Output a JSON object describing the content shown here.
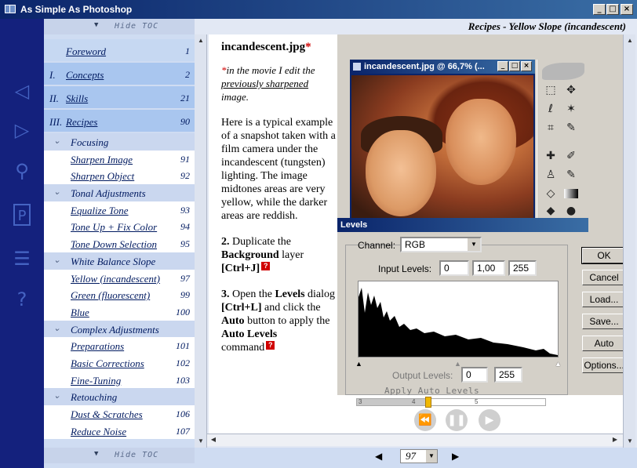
{
  "window": {
    "title": "As Simple As Photoshop"
  },
  "toc": {
    "hide_label": "Hide TOC",
    "items": [
      {
        "type": "chapter",
        "roman": "",
        "label": "Foreword",
        "page": "1"
      },
      {
        "type": "chapter",
        "roman": "I.",
        "label": "Concepts",
        "page": "2"
      },
      {
        "type": "chapter",
        "roman": "II.",
        "label": "Skills",
        "page": "21"
      },
      {
        "type": "chapter",
        "roman": "III.",
        "label": "Recipes",
        "page": "90"
      },
      {
        "type": "section",
        "label": "Focusing"
      },
      {
        "type": "leaf",
        "label": "Sharpen Image",
        "page": "91"
      },
      {
        "type": "leaf",
        "label": "Sharpen Object",
        "page": "92"
      },
      {
        "type": "section",
        "label": "Tonal Adjustments"
      },
      {
        "type": "leaf",
        "label": "Equalize Tone",
        "page": "93"
      },
      {
        "type": "leaf",
        "label": "Tone Up + Fix Color",
        "page": "94"
      },
      {
        "type": "leaf",
        "label": "Tone Down Selection",
        "page": "95"
      },
      {
        "type": "section",
        "label": "White Balance Slope"
      },
      {
        "type": "leaf",
        "label": "Yellow (incandescent)",
        "page": "97"
      },
      {
        "type": "leaf",
        "label": "Green (fluorescent)",
        "page": "99"
      },
      {
        "type": "leaf",
        "label": "Blue",
        "page": "100"
      },
      {
        "type": "section",
        "label": "Complex Adjustments"
      },
      {
        "type": "leaf",
        "label": "Preparations",
        "page": "101"
      },
      {
        "type": "leaf",
        "label": "Basic Corrections",
        "page": "102"
      },
      {
        "type": "leaf",
        "label": "Fine-Tuning",
        "page": "103"
      },
      {
        "type": "section",
        "label": "Retouching"
      },
      {
        "type": "leaf",
        "label": "Dust & Scratches",
        "page": "106"
      },
      {
        "type": "leaf",
        "label": "Reduce Noise",
        "page": "107"
      }
    ]
  },
  "content": {
    "title": "Recipes - Yellow Slope (incandescent)",
    "filename": "incandescent.jpg",
    "note_before": "in the movie I edit the ",
    "note_link": "previously sharpened",
    "note_after": " image.",
    "para1": "Here is a typical example of a snapshot taken with a film camera under the incandescent (tungsten) lighting. The image midtones areas are very yellow, while the darker areas are reddish.",
    "step2_num": "2.",
    "step2_text1": " Duplicate the ",
    "step2_bold": "Background",
    "step2_text2": " layer ",
    "step2_key": "[Ctrl+J]",
    "step3_num": "3.",
    "step3_text1": " Open the ",
    "step3_bold1": "Levels",
    "step3_text2": " dialog ",
    "step3_key": "[Ctrl+L]",
    "step3_text3": " and click the ",
    "step3_bold2": "Auto",
    "step3_text4": " button to apply the ",
    "step3_bold3": "Auto Levels",
    "step3_text5": " command"
  },
  "screenshot": {
    "ps_title": "incandescent.jpg @ 66,7% (...",
    "levels_title": "Levels",
    "channel_label": "Channel:",
    "channel_value": "RGB",
    "input_label": "Input Levels:",
    "input_values": [
      "0",
      "1,00",
      "255"
    ],
    "output_label": "Output Levels:",
    "output_values": [
      "0",
      "255"
    ],
    "buttons": [
      "OK",
      "Cancel",
      "Load...",
      "Save...",
      "Auto",
      "Options..."
    ]
  },
  "player": {
    "caption": "Apply Auto Levels",
    "ticks": [
      "3",
      "4",
      "5"
    ],
    "position": 0.38
  },
  "pagenav": {
    "page": "97"
  }
}
